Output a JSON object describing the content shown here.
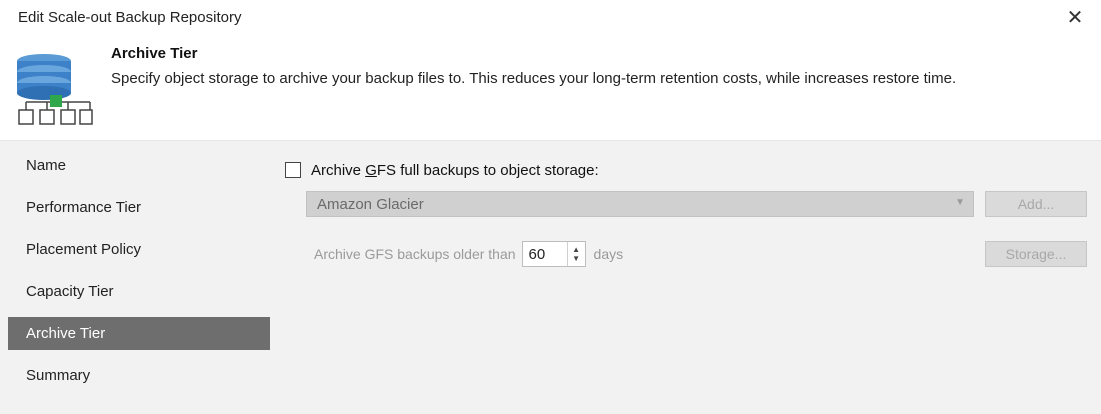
{
  "window": {
    "title": "Edit Scale-out Backup Repository",
    "close_icon": "close-icon"
  },
  "header": {
    "icon": "database-icon",
    "title": "Archive Tier",
    "description": "Specify object storage to archive your backup files to. This reduces your long-term retention costs, while increases restore time."
  },
  "sidebar": {
    "items": [
      {
        "label": "Name"
      },
      {
        "label": "Performance Tier"
      },
      {
        "label": "Placement Policy"
      },
      {
        "label": "Capacity Tier"
      },
      {
        "label": "Archive Tier",
        "active": true
      },
      {
        "label": "Summary"
      }
    ]
  },
  "archive": {
    "checkbox_checked": false,
    "checkbox_label_pre": "Archive ",
    "checkbox_label_mnemonic": "G",
    "checkbox_label_post": "FS full backups to object storage:",
    "storage_selected": "Amazon Glacier",
    "add_label": "Add...",
    "older_than_label": "Archive GFS backups older than",
    "older_than_value": "60",
    "older_than_unit": "days",
    "storage_label": "Storage..."
  },
  "colors": {
    "active_nav_bg": "#6e6e6e",
    "content_bg": "#f2f2f2",
    "disabled_text": "#9a9a9a",
    "icon_blue": "#3d82c9",
    "icon_green": "#2ea84a"
  }
}
